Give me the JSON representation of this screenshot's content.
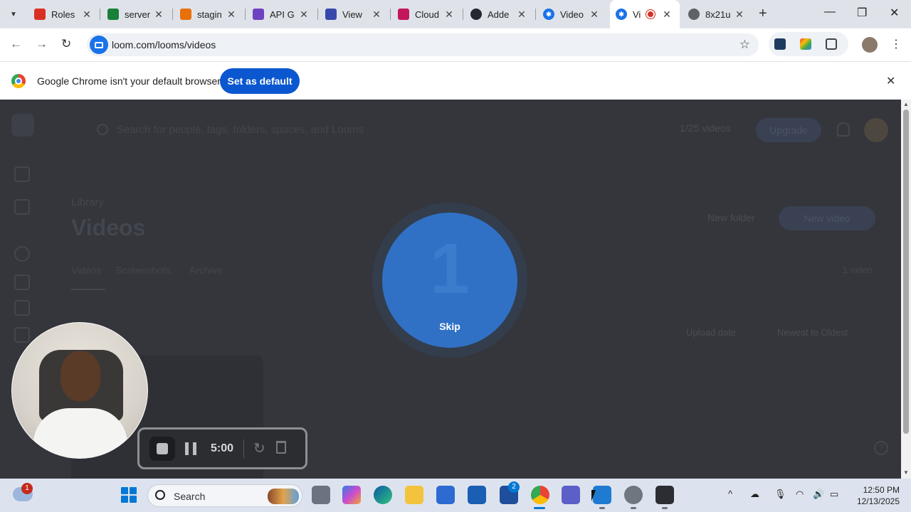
{
  "browser": {
    "tabs": [
      {
        "title": "Roles",
        "color": "#d93025",
        "active": false
      },
      {
        "title": "server",
        "color": "#188038",
        "active": false
      },
      {
        "title": "stagin",
        "color": "#e8710a",
        "active": false
      },
      {
        "title": "API G",
        "color": "#6f42c1",
        "active": false
      },
      {
        "title": "View",
        "color": "#3949ab",
        "active": false
      },
      {
        "title": "Cloud",
        "color": "#c2185b",
        "active": false
      },
      {
        "title": "Adde",
        "color": "#24292f",
        "active": false
      },
      {
        "title": "Video",
        "color": "#1a73e8",
        "active": false
      },
      {
        "title": "Vi",
        "color": "#1a73e8",
        "active": true
      },
      {
        "title": "8x21u",
        "color": "#5f6368",
        "active": false
      }
    ],
    "url": "loom.com/looms/videos",
    "infobar": {
      "message": "Google Chrome isn't your default browser",
      "button": "Set as default"
    }
  },
  "loom_page": {
    "search_placeholder": "Search for people, tags, folders, spaces, and Looms",
    "video_count": "1/25 videos",
    "upgrade": "Upgrade",
    "breadcrumb": "Library",
    "title": "Videos",
    "tabs": [
      "Videos",
      "Screenshots",
      "Archive"
    ],
    "count_label": "1 video",
    "new_folder": "New folder",
    "new_video": "New video",
    "filters": [
      "Upload date",
      "Newest to Oldest"
    ]
  },
  "countdown": {
    "number": "1",
    "skip": "Skip"
  },
  "recorder": {
    "time": "5:00"
  },
  "taskbar": {
    "weather_badge": "1",
    "search_label": "Search",
    "mail_badge": "2",
    "time": "12:50 PM",
    "date": "12/13/2025"
  }
}
